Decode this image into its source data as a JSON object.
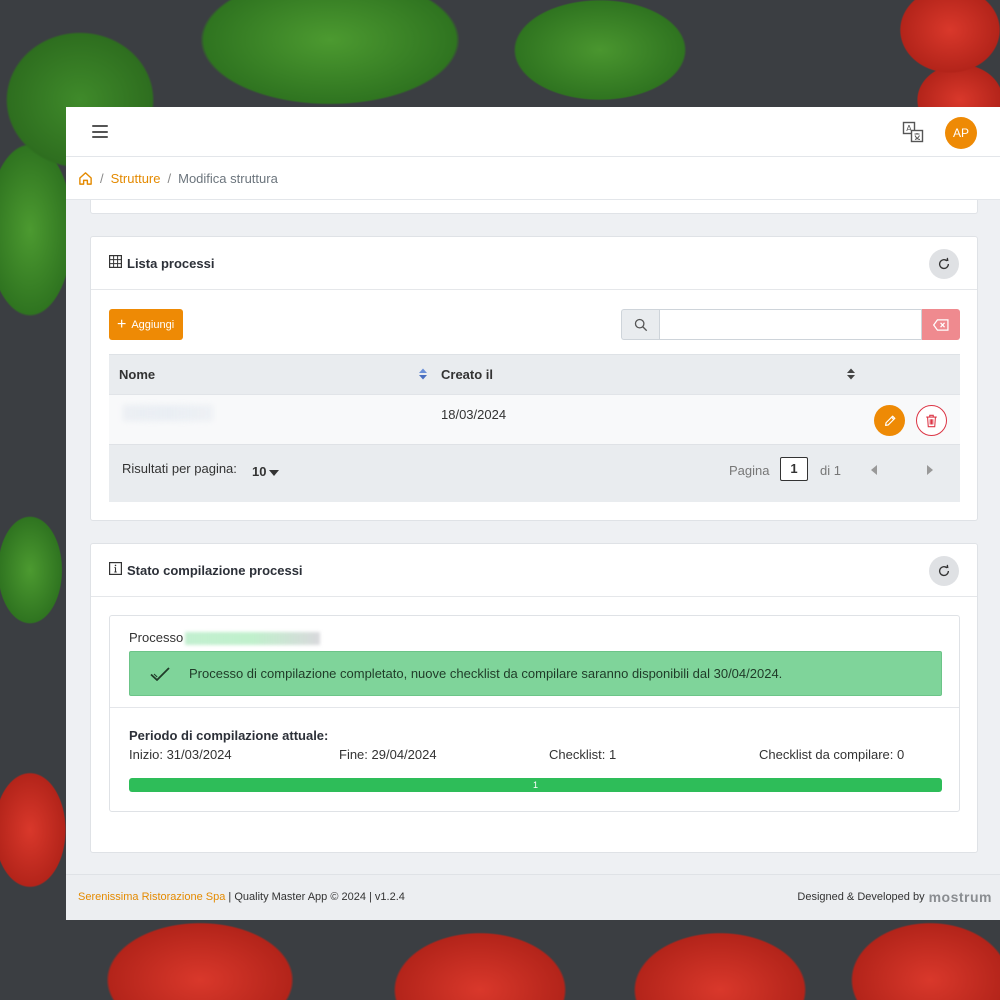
{
  "header": {
    "menu_icon": "hamburger-menu-icon",
    "translate_icon": "translate-icon",
    "avatar_initials": "AP",
    "accent_color": "#ee8a05"
  },
  "breadcrumb": {
    "home_icon": "home-icon",
    "separator": "/",
    "items": [
      "Strutture",
      "Modifica struttura"
    ]
  },
  "processes_card": {
    "icon": "table-grid-icon",
    "title": "Lista processi",
    "refresh_icon": "refresh-icon",
    "add_label": "Aggiungi",
    "search": {
      "icon": "search-icon",
      "value": "",
      "placeholder": "",
      "clear_icon": "backspace-icon"
    },
    "table": {
      "columns": [
        "Nome",
        "Creato il"
      ],
      "rows": [
        {
          "nome": "",
          "creato_il": "18/03/2024",
          "actions": [
            "edit-icon",
            "trash-icon"
          ]
        }
      ]
    },
    "pagination": {
      "per_page_label": "Risultati per pagina:",
      "per_page_value": "10",
      "page_label": "Pagina",
      "current_page": "1",
      "of_label": "di 1"
    }
  },
  "status_card": {
    "icon": "info-square-icon",
    "title": "Stato compilazione processi",
    "refresh_icon": "refresh-icon",
    "processo_label": "Processo",
    "alert": {
      "icon": "check-icon",
      "text": "Processo di compilazione completato, nuove checklist da compilare saranno disponibili dal 30/04/2024.",
      "color": "#7fd49a"
    },
    "period": {
      "title": "Periodo di compilazione attuale:",
      "inizio": "Inizio: 31/03/2024",
      "fine": "Fine: 29/04/2024",
      "checklist": "Checklist: 1",
      "da_compilare": "Checklist da compilare: 0"
    },
    "progress": {
      "value": 1,
      "max": 1,
      "label": "1",
      "color": "#2ebd59"
    }
  },
  "footer": {
    "company": "Serenissima Ristorazione Spa",
    "app_info": " | Quality Master App © 2024 | v1.2.4",
    "designed_by": "Designed & Developed by",
    "brand": "mostrum"
  }
}
